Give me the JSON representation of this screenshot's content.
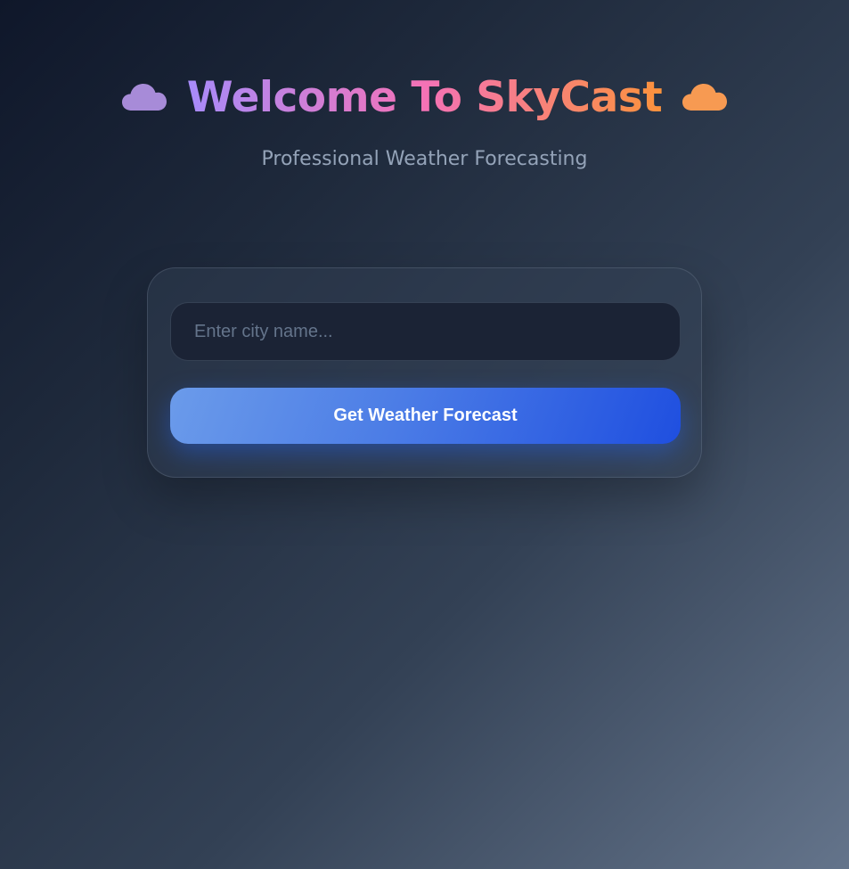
{
  "header": {
    "title": "Welcome To SkyCast",
    "subtitle": "Professional Weather Forecasting",
    "left_icon": "cloud-icon",
    "right_icon": "cloud-icon",
    "title_gradient": [
      "#a78bfa",
      "#f472b6",
      "#fb923c"
    ]
  },
  "search": {
    "placeholder": "Enter city name...",
    "value": "",
    "button_label": "Get Weather Forecast"
  },
  "colors": {
    "background_start": "#0f172a",
    "background_end": "#64748b",
    "button_start": "#6b9bea",
    "button_end": "#1f4fe0",
    "left_cloud": "#a78bd8",
    "right_cloud": "#f79a52"
  }
}
